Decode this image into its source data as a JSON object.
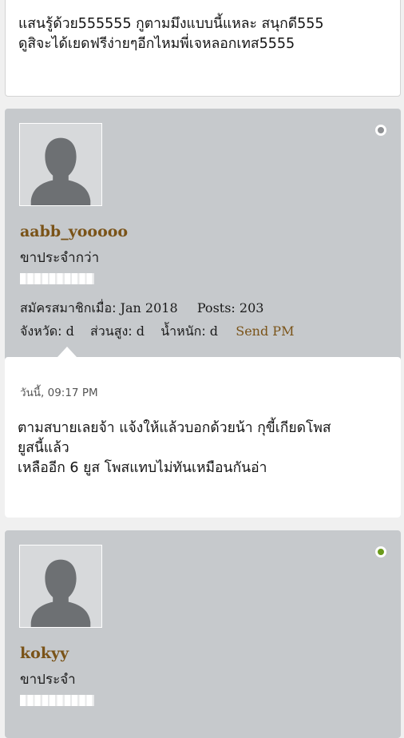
{
  "posts": [
    {
      "body_lines": [
        "แสนรู้ด้วย555555 กูตามมึงแบบนี้แหละ สนุกดี555",
        "ดูสิจะได้เยดฟรีง่ายๆอีกไหมพี่เจหลอกเทส5555"
      ]
    },
    {
      "username": "aabb_yooooo",
      "rank": "ขาประจำกว่า",
      "online": false,
      "joined_label": "สมัครสมาชิกเมื่อ:",
      "joined_value": "Jan 2018",
      "posts_label": "Posts:",
      "posts_value": "203",
      "province_label": "จังหวัด:",
      "province_value": "d",
      "height_label": "ส่วนสูง:",
      "height_value": "d",
      "weight_label": "น้ำหนัก:",
      "weight_value": "d",
      "send_pm": "Send PM",
      "timestamp": "วันนี้, 09:17 PM",
      "body_lines": [
        "ตามสบายเลยจ้า แจ้งให้แล้วบอกด้วยน้า กุขี้เกียดโพส",
        "ยูสนี้แล้ว",
        "เหลืออีก 6 ยูส โพสแทบไม่ทันเหมือนกันอ่า"
      ]
    },
    {
      "username": "kokyy",
      "rank": "ขาประจำ",
      "online": true
    }
  ],
  "colors": {
    "username": "#7a5318",
    "online": "#6a9a1a",
    "offline": "#8e9093",
    "profile_bg": "#c6c9cc"
  },
  "icons": {
    "avatar": "default-user-silhouette",
    "status": "circle-dot"
  }
}
